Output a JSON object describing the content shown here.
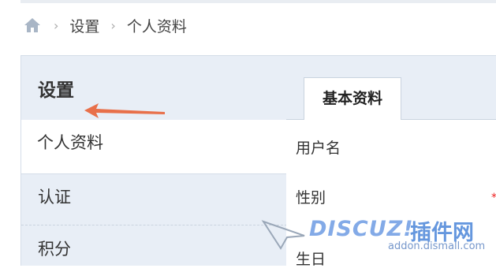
{
  "breadcrumb": {
    "home_icon": "home-icon",
    "separator": "›",
    "items": [
      "设置",
      "个人资料"
    ]
  },
  "sidebar": {
    "title": "设置",
    "items": [
      {
        "label": "个人资料",
        "active": true
      },
      {
        "label": "认证",
        "active": false
      },
      {
        "label": "积分",
        "active": false
      }
    ]
  },
  "main": {
    "tab_label": "基本资料",
    "fields": [
      "用户名",
      "性别",
      "生日"
    ],
    "required_mark": "*"
  },
  "watermark": {
    "brand": "DISCUZ!",
    "name_cn": "插件网",
    "url": "addon.dismall.com"
  },
  "colors": {
    "sidebar_bg": "#e8eef6",
    "annotation_arrow": "#e8704a",
    "watermark_blue": "#3b7bd6",
    "required": "#e22222"
  }
}
